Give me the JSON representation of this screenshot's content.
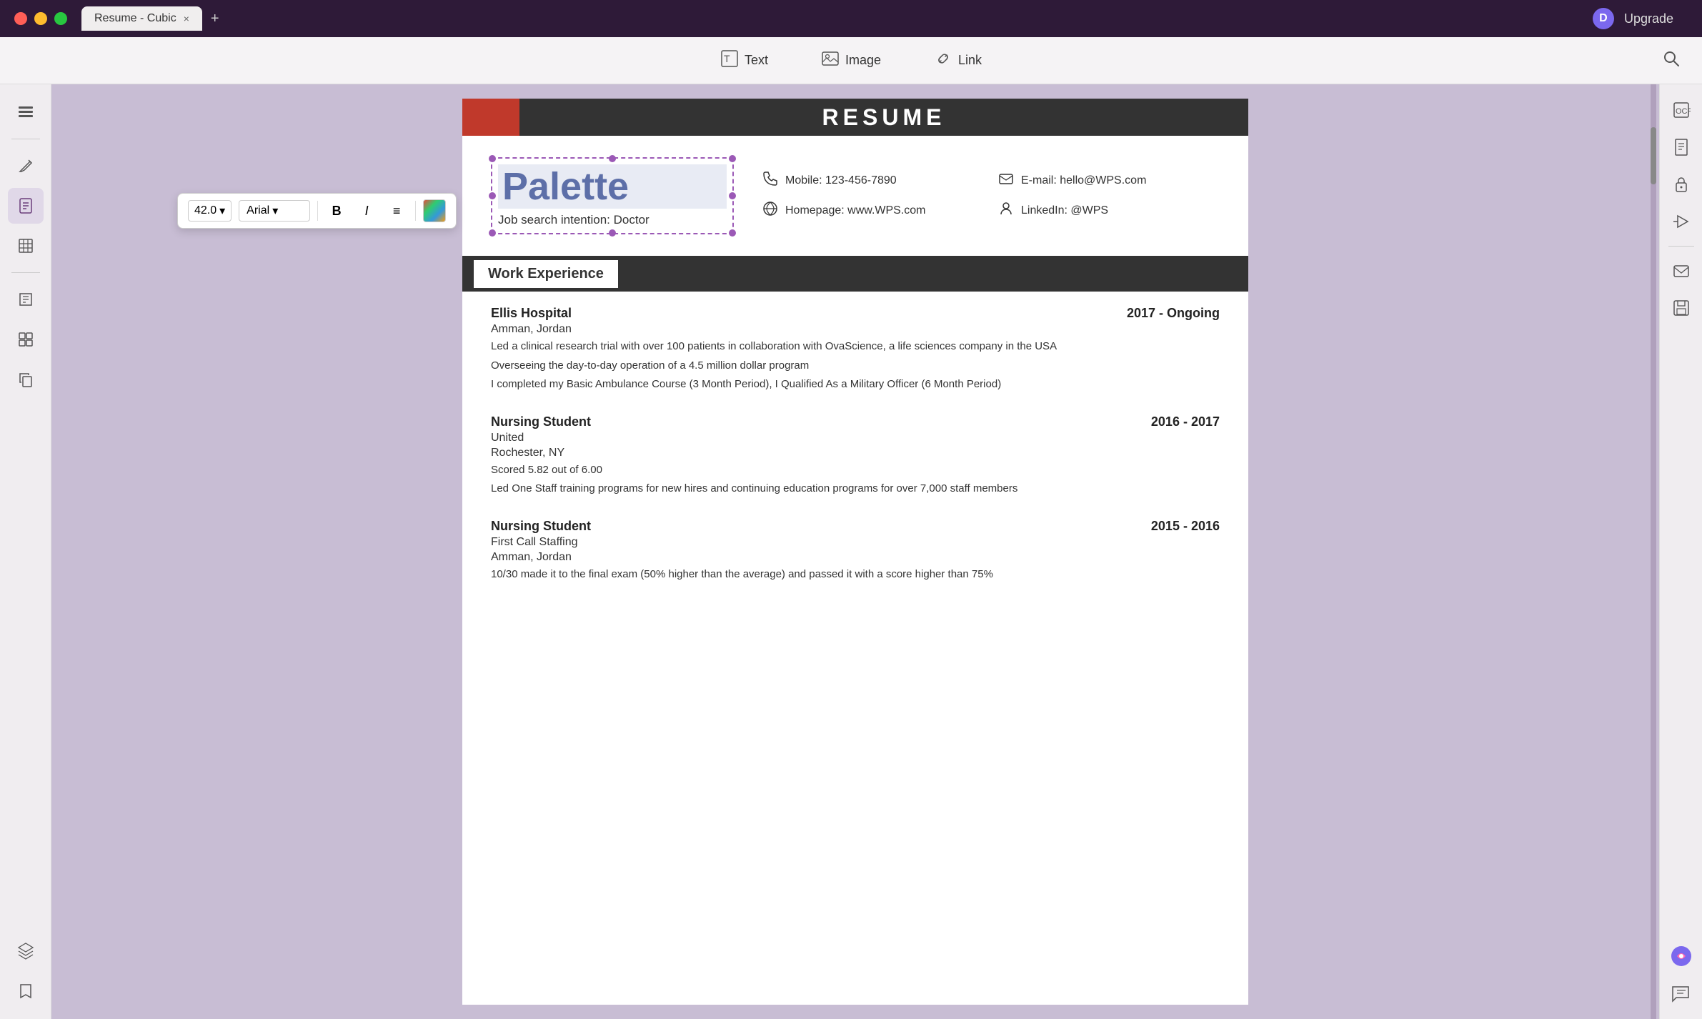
{
  "titlebar": {
    "tab_label": "Resume - Cubic",
    "close_icon": "×",
    "add_tab_icon": "+"
  },
  "toolbar": {
    "text_label": "Text",
    "image_label": "Image",
    "link_label": "Link",
    "upgrade_label": "Upgrade"
  },
  "format_toolbar": {
    "font_size": "42.0",
    "font_family": "Arial",
    "bold_label": "B",
    "italic_label": "I",
    "list_icon": "≡",
    "chevron": "▾"
  },
  "resume": {
    "title": "RESUME",
    "name": "Palette",
    "job_intention_label": "Job search intention:",
    "job_intention_value": "Doctor",
    "contacts": [
      {
        "icon": "📞",
        "label": "Mobile: 123-456-7890"
      },
      {
        "icon": "✉",
        "label": "E-mail: hello@WPS.com"
      },
      {
        "icon": "🌐",
        "label": "Homepage: www.WPS.com"
      },
      {
        "icon": "👤",
        "label": "LinkedIn: @WPS"
      }
    ]
  },
  "sections": {
    "work_experience_label": "Work Experience",
    "jobs": [
      {
        "company": "Ellis Hospital",
        "period": "2017 - Ongoing",
        "location": "Amman,  Jordan",
        "details": [
          "Led a  clinical research trial with over 100 patients in collaboration with OvaScience, a life sciences company in the USA",
          "Overseeing the day-to-day operation of a 4.5 million dollar program",
          "I completed my Basic Ambulance Course (3 Month Period), I Qualified As a Military Officer (6 Month Period)"
        ]
      },
      {
        "company": "Nursing Student",
        "sub_company": "United",
        "period": "2016 - 2017",
        "location": "Rochester, NY",
        "details": [
          "Scored 5.82 out of 6.00",
          "Led  One  Staff  training  programs  for  new hires and continuing education programs for over 7,000 staff members"
        ]
      },
      {
        "company": "Nursing Student",
        "sub_company": "First Call Staffing",
        "period": "2015 - 2016",
        "location": "Amman,  Jordan",
        "details": [
          "10/30  made it to the final exam (50% higher than the average) and passed it with a score  higher than 75%"
        ]
      }
    ]
  },
  "sidebar_left": {
    "icons": [
      "≡",
      "🔍",
      "✏",
      "📋",
      "📝",
      "📊",
      "🖼",
      "📎"
    ],
    "bottom_icons": [
      "⬡",
      "🔖"
    ]
  },
  "sidebar_right": {
    "icons": [
      "⬜",
      "📄",
      "🔒",
      "📤",
      "✉",
      "💾",
      "🤖",
      "💬"
    ]
  },
  "colors": {
    "titlebar_bg": "#2e1a38",
    "toolbar_bg": "#f5f3f5",
    "sidebar_bg": "#f0edf0",
    "document_bg": "#c8bdd4",
    "resume_header_dark": "#333333",
    "resume_red": "#c0392b",
    "section_header": "#333333",
    "name_color": "#5d6fa8"
  }
}
